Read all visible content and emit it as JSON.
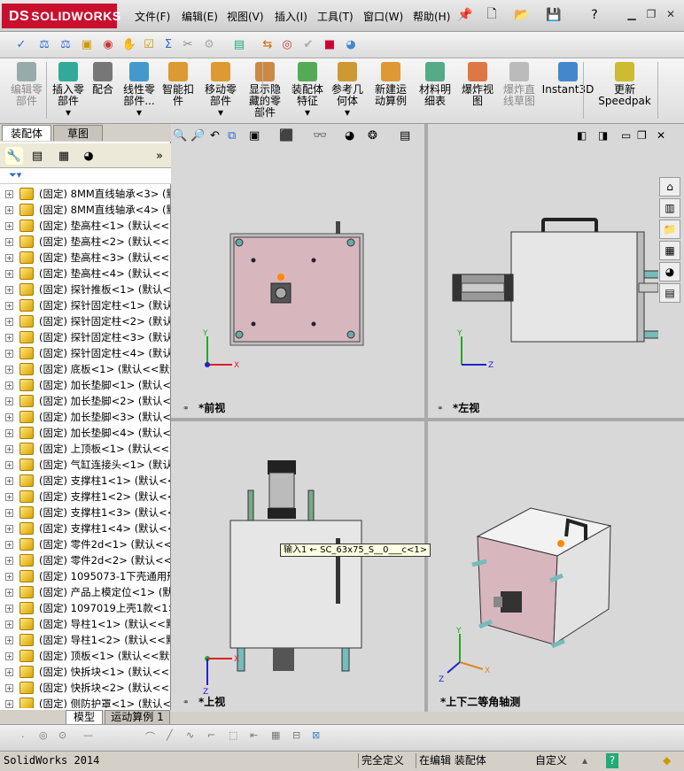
{
  "app": {
    "logo_text": "SOLIDWORKS",
    "logo_ds": "DS"
  },
  "menu": [
    "文件(F)",
    "编辑(E)",
    "视图(V)",
    "插入(I)",
    "工具(T)",
    "窗口(W)",
    "帮助(H)"
  ],
  "ribbon": [
    {
      "label": "编辑零\n部件",
      "disabled": true,
      "color": "#9aa"
    },
    {
      "label": "插入零\n部件\n▾",
      "disabled": false,
      "color": "#3a9"
    },
    {
      "label": "配合",
      "disabled": false,
      "color": "#777"
    },
    {
      "label": "线性零\n部件...\n▾",
      "disabled": false,
      "color": "#49c"
    },
    {
      "label": "智能扣\n件",
      "disabled": false,
      "color": "#d93"
    },
    {
      "label": "移动零\n部件\n▾",
      "disabled": false,
      "color": "#d93"
    },
    {
      "label": "显示隐\n藏的零\n部件",
      "disabled": false,
      "color": "#c84"
    },
    {
      "label": "装配体\n特征\n▾",
      "disabled": false,
      "color": "#5a5"
    },
    {
      "label": "参考几\n何体\n▾",
      "disabled": false,
      "color": "#c93"
    },
    {
      "label": "新建运\n动算例",
      "disabled": false,
      "color": "#d93"
    },
    {
      "label": "材料明\n细表",
      "disabled": false,
      "color": "#5a8"
    },
    {
      "label": "爆炸视\n图",
      "disabled": false,
      "color": "#d74"
    },
    {
      "label": "爆炸直\n线草图",
      "disabled": true,
      "color": "#bbb"
    },
    {
      "label": "Instant3D",
      "disabled": false,
      "color": "#48c"
    },
    {
      "label": "更新\nSpeedpak",
      "disabled": false,
      "color": "#cb3"
    }
  ],
  "left_panel": {
    "tabs": [
      "装配体",
      "草图"
    ],
    "tree": [
      "(固定) 8MM直线轴承<3> (默",
      "(固定) 8MM直线轴承<4> (默",
      "(固定) 垫高柱<1> (默认<<9",
      "(固定) 垫高柱<2> (默认<<9",
      "(固定) 垫高柱<3> (默认<<9",
      "(固定) 垫高柱<4> (默认<<9",
      "(固定) 探针推板<1> (默认<",
      "(固定) 探针固定柱<1> (默认",
      "(固定) 探针固定柱<2> (默认",
      "(固定) 探针固定柱<3> (默认",
      "(固定) 探针固定柱<4> (默认",
      "(固定) 底板<1> (默认<<默认",
      "(固定) 加长垫脚<1> (默认<",
      "(固定) 加长垫脚<2> (默认<",
      "(固定) 加长垫脚<3> (默认<",
      "(固定) 加长垫脚<4> (默认<",
      "(固定) 上顶板<1> (默认<<",
      "(固定) 气缸连接头<1> (默认",
      "(固定) 支撑柱1<1> (默认<<",
      "(固定) 支撑柱1<2> (默认<<",
      "(固定) 支撑柱1<3> (默认<<",
      "(固定) 支撑柱1<4> (默认<<",
      "(固定) 零件2d<1> (默认<<9",
      "(固定) 零件2d<2> (默认<<9",
      "(固定) 1095073-1下壳通用形",
      "(固定) 产品上模定位<1> (默",
      "(固定) 1097019上壳1款<1> (",
      "(固定) 导柱1<1> (默认<<默",
      "(固定) 导柱1<2> (默认<<默",
      "(固定) 顶板<1> (默认<<默认",
      "(固定) 快拆块<1> (默认<<9",
      "(固定) 快拆块<2> (默认<<9",
      "(固定) 侧防护罩<1> (默认<"
    ],
    "bottom_tabs": [
      "模型",
      "运动算例 1"
    ]
  },
  "viewports": [
    {
      "label": "*前视",
      "axes": [
        "Y",
        "X"
      ]
    },
    {
      "label": "*左视",
      "axes": [
        "Y",
        "Z"
      ]
    },
    {
      "label": "*上视",
      "axes": [
        "X",
        "Z"
      ]
    },
    {
      "label": "*上下二等角轴测",
      "axes": [
        "Y",
        "X",
        "Z"
      ]
    }
  ],
  "tooltip": "输入1 ← SC_63x75_S__0___c<1>",
  "status": {
    "app": "SolidWorks 2014",
    "defined": "完全定义",
    "editing": "在编辑 装配体",
    "units": "自定义",
    "help": "?"
  }
}
